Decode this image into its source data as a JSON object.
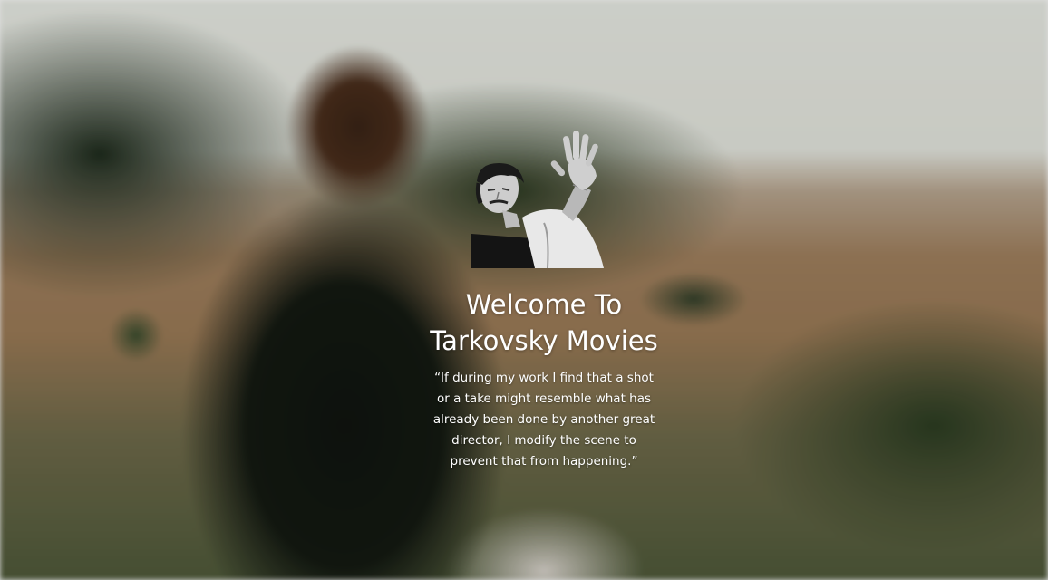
{
  "hero": {
    "portrait_icon": "tarkovsky-portrait",
    "title_line1": "Welcome To",
    "title_line2": "Tarkovsky Movies",
    "quote": "“If during my work I find that a shot or a take might resemble what has already been done by another great director, I modify the scene to prevent that from happening.”"
  },
  "colors": {
    "text": "#ffffff",
    "background_sky": "#e8ebe4",
    "background_field": "#9a7a56",
    "background_foliage": "#2c3d22"
  }
}
